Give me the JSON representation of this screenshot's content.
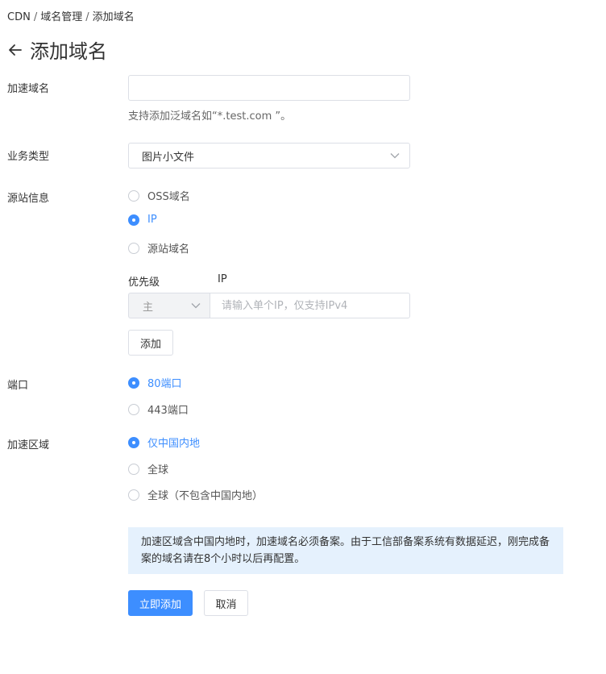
{
  "breadcrumb": {
    "items": [
      "CDN",
      "域名管理",
      "添加域名"
    ],
    "separator": "/"
  },
  "page": {
    "title": "添加域名"
  },
  "form": {
    "domain": {
      "label": "加速域名",
      "value": "",
      "placeholder": "",
      "hint": "支持添加泛域名如“*.test.com ”。"
    },
    "business_type": {
      "label": "业务类型",
      "selected": "图片小文件"
    },
    "origin": {
      "label": "源站信息",
      "options": [
        "OSS域名",
        "IP",
        "源站域名"
      ],
      "selected_index": 1,
      "priority_header": "优先级",
      "ip_header": "IP",
      "priority_value": "主",
      "ip_placeholder": "请输入单个IP，仅支持IPv4",
      "add_label": "添加"
    },
    "port": {
      "label": "端口",
      "options": [
        "80端口",
        "443端口"
      ],
      "selected_index": 0
    },
    "region": {
      "label": "加速区域",
      "options": [
        "仅中国内地",
        "全球",
        "全球（不包含中国内地）"
      ],
      "selected_index": 0
    },
    "notice": "加速区域含中国内地时，加速域名必须备案。由于工信部备案系统有数据延迟，刚完成备案的域名请在8个小时以后再配置。",
    "submit_label": "立即添加",
    "cancel_label": "取消"
  },
  "colors": {
    "accent": "#3d8eff",
    "notice_bg": "#e5f1fd",
    "border": "#dcdfe6"
  },
  "icons": {
    "back": "arrow-left-icon",
    "dropdown": "chevron-down-icon"
  }
}
